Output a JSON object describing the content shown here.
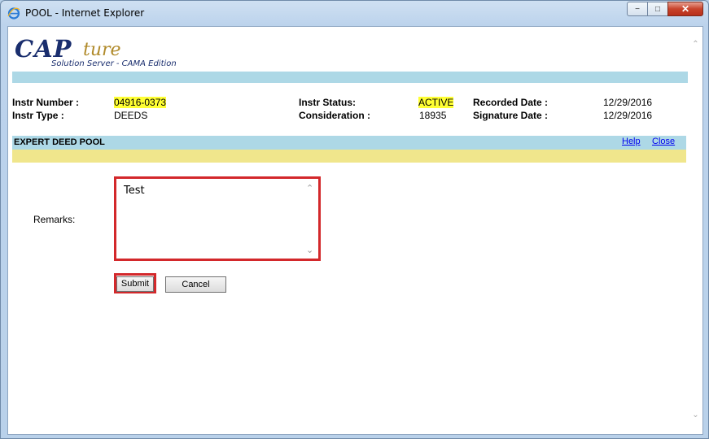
{
  "window": {
    "title": "POOL - Internet Explorer",
    "controls": {
      "minimize": "−",
      "maximize": "□",
      "close": "✕"
    }
  },
  "logo": {
    "main": "CAP",
    "script": "ture",
    "subtitle": "Solution Server - CAMA Edition"
  },
  "instrument": {
    "number_label": "Instr Number :",
    "number_value": "04916-0373",
    "type_label": "Instr Type :",
    "type_value": "DEEDS",
    "status_label": "Instr Status:",
    "status_value": "ACTIVE",
    "consideration_label": "Consideration :",
    "consideration_value": "18935",
    "recorded_label": "Recorded Date :",
    "recorded_value": "12/29/2016",
    "signature_label": "Signature Date :",
    "signature_value": "12/29/2016"
  },
  "section": {
    "title": "EXPERT DEED POOL",
    "help_link": "Help",
    "close_link": "Close"
  },
  "form": {
    "remarks_label": "Remarks:",
    "remarks_value": "Test",
    "submit_label": "Submit",
    "cancel_label": "Cancel"
  },
  "colors": {
    "highlight": "#ffff33",
    "band_blue": "#add8e6",
    "band_yellow": "#f0e68c",
    "focus_red": "#d3282b"
  }
}
